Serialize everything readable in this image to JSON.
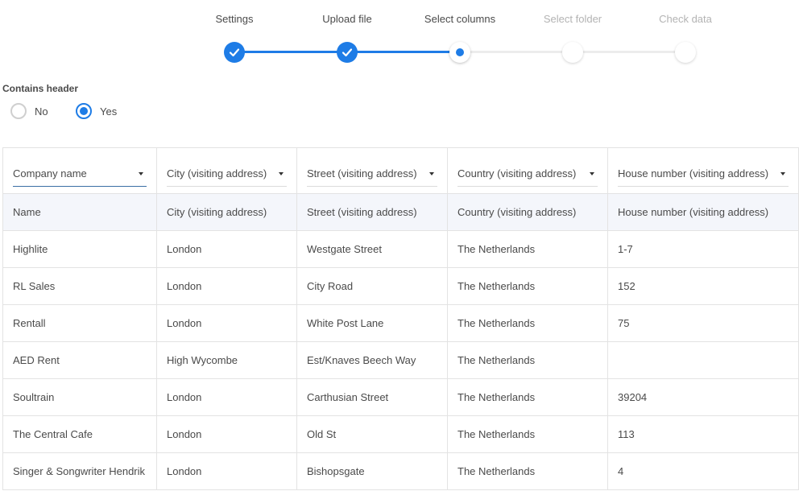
{
  "stepper": {
    "steps": [
      {
        "label": "Settings",
        "state": "done"
      },
      {
        "label": "Upload file",
        "state": "done"
      },
      {
        "label": "Select columns",
        "state": "current"
      },
      {
        "label": "Select folder",
        "state": "todo"
      },
      {
        "label": "Check data",
        "state": "todo"
      }
    ]
  },
  "header_option": {
    "label": "Contains header",
    "options": [
      {
        "label": "No",
        "checked": false
      },
      {
        "label": "Yes",
        "checked": true
      }
    ]
  },
  "column_selects": [
    "Company name",
    "City (visiting address)",
    "Street (visiting address)",
    "Country (visiting address)",
    "House number (visiting address)"
  ],
  "header_row": [
    "Name",
    "City (visiting address)",
    "Street (visiting address)",
    "Country (visiting address)",
    "House number (visiting address)"
  ],
  "rows": [
    [
      "Highlite",
      "London",
      "Westgate Street",
      "The Netherlands",
      "1-7"
    ],
    [
      "RL Sales",
      "London",
      "City Road",
      "The Netherlands",
      "152"
    ],
    [
      "Rentall",
      "London",
      "White Post Lane",
      "The Netherlands",
      "75"
    ],
    [
      "AED Rent",
      "High Wycombe",
      "Est/Knaves Beech Way",
      "The Netherlands",
      ""
    ],
    [
      "Soultrain",
      "London",
      "Carthusian Street",
      "The Netherlands",
      "39204"
    ],
    [
      "The Central Cafe",
      "London",
      "Old St",
      "The Netherlands",
      "113"
    ],
    [
      "Singer & Songwriter Hendrik",
      "London",
      "Bishopsgate",
      "The Netherlands",
      "4"
    ]
  ],
  "colors": {
    "accent": "#1e7ce6",
    "header_row_bg": "#f4f6fb",
    "border": "#e3e3e3"
  }
}
